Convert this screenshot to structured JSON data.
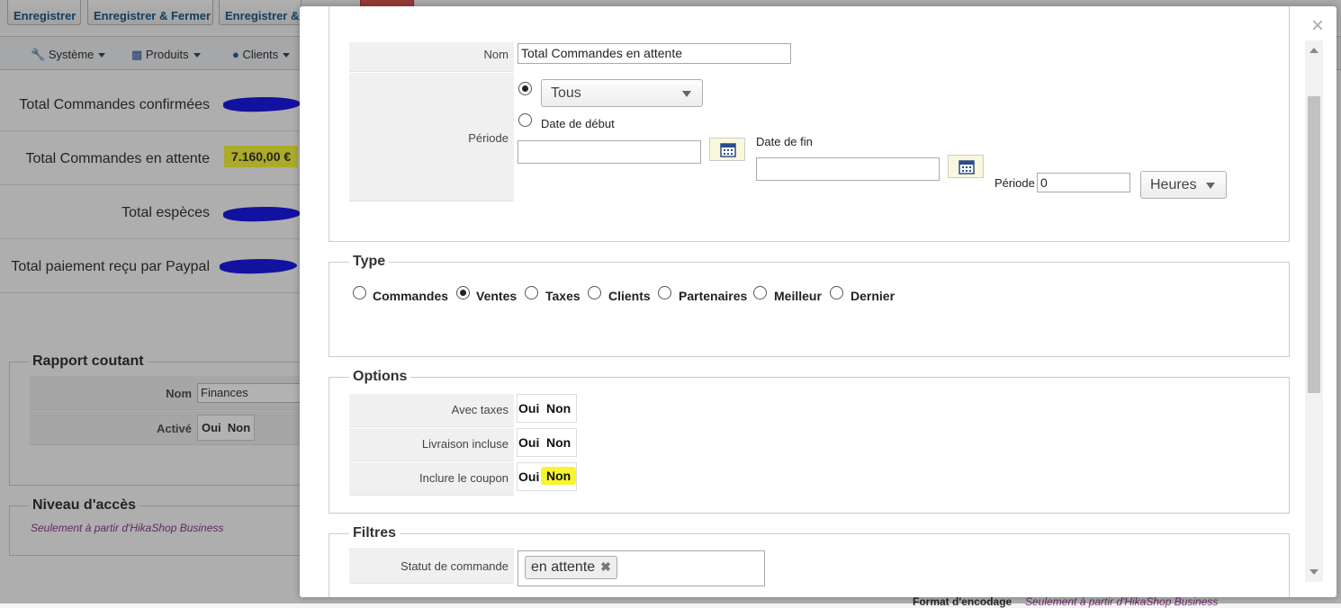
{
  "toolbar": {
    "save": "Enregistrer",
    "save_close": "Enregistrer & Fermer",
    "save_new": "Enregistrer &"
  },
  "menu": {
    "system": "Système",
    "products": "Produits",
    "clients": "Clients"
  },
  "dashboard": {
    "confirmed": "Total Commandes confirmées",
    "pending": "Total Commandes en attente",
    "pending_value": "7.160,00 €",
    "cash": "Total espèces",
    "paypal": "Total paiement reçu par Paypal"
  },
  "report": {
    "legend": "Rapport coutant",
    "name_label": "Nom",
    "name_value": "Finances",
    "active_label": "Activé",
    "yes": "Oui",
    "no": "Non"
  },
  "access": {
    "legend": "Niveau d'accès",
    "note": "Seulement à partir d'HikaShop Business"
  },
  "encoding": {
    "label": "Format d'encodage",
    "note": "Seulement à partir d'HikaShop Business"
  },
  "modal": {
    "name_label": "Nom",
    "name_value": "Total Commandes en attente",
    "period_label": "Période",
    "period_select": "Tous",
    "start_label": "Date de début",
    "end_label": "Date de fin",
    "period2_label": "Période",
    "period2_value": "0",
    "unit_select": "Heures",
    "type_legend": "Type",
    "types": [
      "Commandes",
      "Ventes",
      "Taxes",
      "Clients",
      "Partenaires",
      "Meilleur",
      "Dernier"
    ],
    "types_selected": 1,
    "options_legend": "Options",
    "options": [
      {
        "label": "Avec taxes",
        "yes": "Oui",
        "no": "Non"
      },
      {
        "label": "Livraison incluse",
        "yes": "Oui",
        "no": "Non"
      },
      {
        "label": "Inclure le coupon",
        "yes": "Oui",
        "no": "Non"
      }
    ],
    "filters_legend": "Filtres",
    "status_label": "Statut de commande",
    "status_tag": "en attente",
    "close": "×"
  },
  "colors": {
    "highlight": "#f7f52d",
    "scribble": "#1a1ae6",
    "link": "#1a5a8a",
    "note": "#8a3a8a"
  }
}
